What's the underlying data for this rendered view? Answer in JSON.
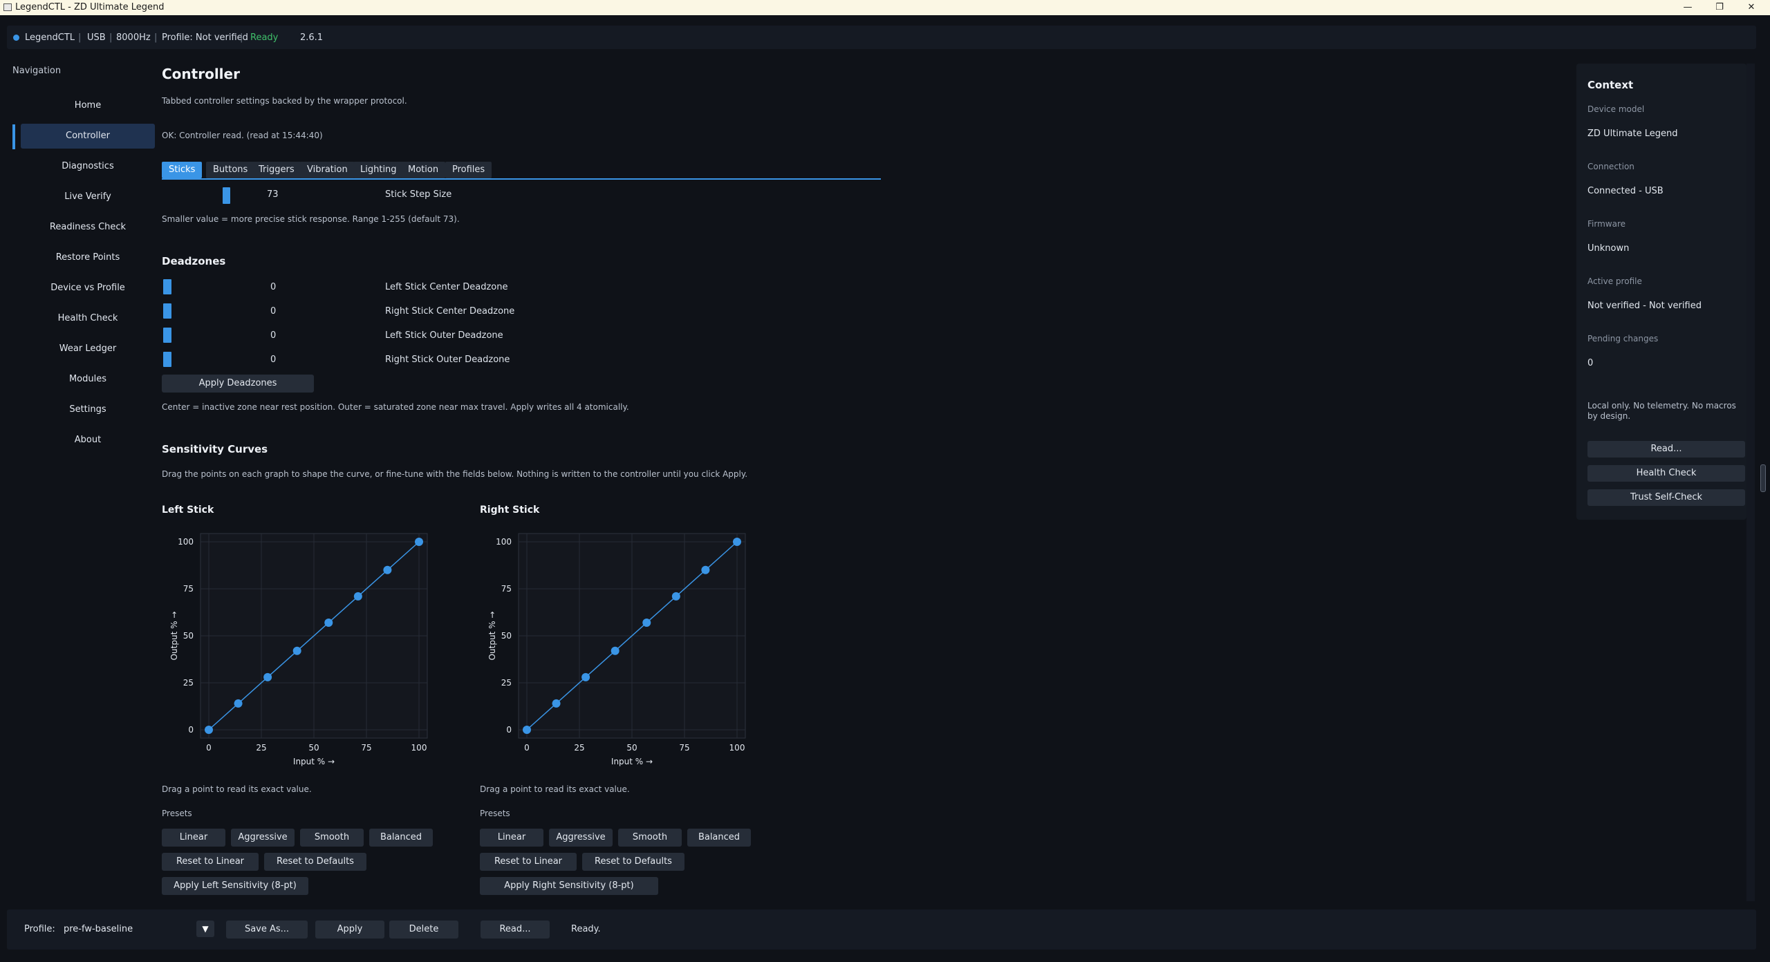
{
  "window": {
    "title": "LegendCTL - ZD Ultimate Legend"
  },
  "status": {
    "app": "LegendCTL",
    "conn": "USB",
    "rate": "8000Hz",
    "profile": "Profile: Not verified",
    "state": "Ready",
    "version": "2.6.1"
  },
  "nav": {
    "title": "Navigation",
    "items": [
      "Home",
      "Controller",
      "Diagnostics",
      "Live Verify",
      "Readiness Check",
      "Restore Points",
      "Device vs Profile",
      "Health Check",
      "Wear Ledger",
      "Modules",
      "Settings",
      "About"
    ],
    "active": "Controller"
  },
  "page": {
    "title": "Controller",
    "subtitle": "Tabbed controller settings backed by the wrapper protocol.",
    "read_status": "OK: Controller read. (read at 15:44:40)"
  },
  "tabs": [
    "Sticks",
    "Buttons",
    "Triggers",
    "Vibration",
    "Lighting",
    "Motion",
    "Profiles"
  ],
  "step": {
    "value": "73",
    "label": "Stick Step Size",
    "hint": "Smaller value = more precise stick response. Range 1-255 (default 73).",
    "min": 1,
    "max": 255,
    "current": 73
  },
  "deadzones": {
    "title": "Deadzones",
    "rows": [
      {
        "value": "0",
        "label": "Left Stick Center Deadzone"
      },
      {
        "value": "0",
        "label": "Right Stick Center Deadzone"
      },
      {
        "value": "0",
        "label": "Left Stick Outer Deadzone"
      },
      {
        "value": "0",
        "label": "Right Stick Outer Deadzone"
      }
    ],
    "apply": "Apply Deadzones",
    "hint": "Center = inactive zone near rest position. Outer = saturated zone near max travel. Apply writes all 4 atomically."
  },
  "curves": {
    "title": "Sensitivity Curves",
    "hint": "Drag the points on each graph to shape the curve, or fine-tune with the fields below. Nothing is written to the controller until you click Apply.",
    "drag_hint": "Drag a point to read its exact value.",
    "presets_label": "Presets",
    "presets": [
      "Linear",
      "Aggressive",
      "Smooth",
      "Balanced"
    ],
    "reset_linear": "Reset to Linear",
    "reset_defaults": "Reset to Defaults",
    "apply_left": "Apply Left Sensitivity (8-pt)",
    "apply_right": "Apply Right Sensitivity (8-pt)"
  },
  "chart_data": [
    {
      "type": "line",
      "title": "Left Stick",
      "xlabel": "Input % →",
      "ylabel": "Output % →",
      "xlim": [
        0,
        100
      ],
      "ylim": [
        0,
        100
      ],
      "xticks": [
        "0",
        "25",
        "50",
        "75",
        "100"
      ],
      "yticks": [
        "0",
        "25",
        "50",
        "75",
        "100"
      ],
      "grid": true,
      "x": [
        0,
        14,
        28,
        42,
        57,
        71,
        85,
        100
      ],
      "y": [
        0,
        14,
        28,
        42,
        57,
        71,
        85,
        100
      ]
    },
    {
      "type": "line",
      "title": "Right Stick",
      "xlabel": "Input % →",
      "ylabel": "Output % →",
      "xlim": [
        0,
        100
      ],
      "ylim": [
        0,
        100
      ],
      "xticks": [
        "0",
        "25",
        "50",
        "75",
        "100"
      ],
      "yticks": [
        "0",
        "25",
        "50",
        "75",
        "100"
      ],
      "grid": true,
      "x": [
        0,
        14,
        28,
        42,
        57,
        71,
        85,
        100
      ],
      "y": [
        0,
        14,
        28,
        42,
        57,
        71,
        85,
        100
      ]
    }
  ],
  "context": {
    "title": "Context",
    "fields": [
      {
        "label": "Device model",
        "value": "ZD Ultimate Legend"
      },
      {
        "label": "Connection",
        "value": "Connected - USB"
      },
      {
        "label": "Firmware",
        "value": "Unknown"
      },
      {
        "label": "Active profile",
        "value": "Not verified - Not verified"
      },
      {
        "label": "Pending changes",
        "value": "0"
      }
    ],
    "note": "Local only. No telemetry. No macros by design.",
    "buttons": [
      "Read...",
      "Health Check",
      "Trust Self-Check"
    ]
  },
  "bottom": {
    "profile_label": "Profile:",
    "profile_value": "pre-fw-baseline",
    "save_as": "Save As...",
    "apply": "Apply",
    "delete": "Delete",
    "read": "Read...",
    "status": "Ready."
  },
  "colors": {
    "accent": "#3a95e6",
    "ready": "#3fbf6a",
    "background": "#0f1218"
  }
}
